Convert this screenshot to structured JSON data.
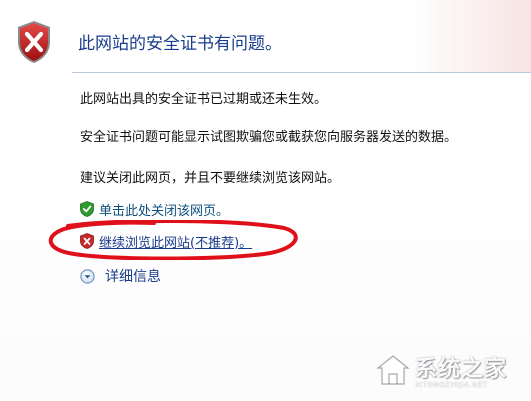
{
  "page": {
    "title": "此网站的安全证书有问题。",
    "messages": [
      "此网站出具的安全证书已过期或还未生效。",
      "安全证书问题可能显示试图欺骗您或截获您向服务器发送的数据。",
      "建议关闭此网页，并且不要继续浏览该网站。"
    ],
    "options": [
      {
        "label": "单击此处关闭该网页。",
        "icon": "green-shield-check-icon"
      },
      {
        "label": "继续浏览此网站(不推荐)。",
        "icon": "red-shield-x-icon"
      }
    ],
    "details_label": "详细信息"
  },
  "watermark": {
    "brand_cn": "系统之家",
    "brand_en": "XITONGZHIJIA.NET"
  },
  "colors": {
    "title": "#1a3c8c",
    "link": "#0d4f7c",
    "annotation": "#e0101a",
    "shield_red": "#c21b1b"
  }
}
